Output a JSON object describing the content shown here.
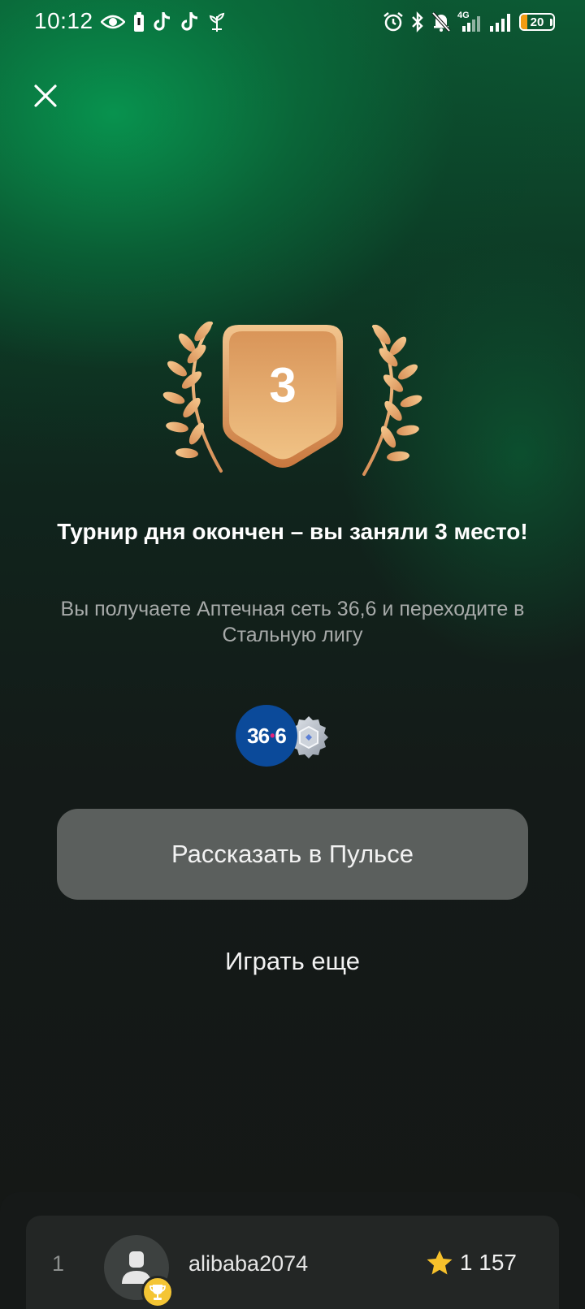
{
  "status_bar": {
    "time": "10:12",
    "network": "4G",
    "battery_level": "20",
    "battery_fraction": 0.2,
    "icons_left": [
      "eye-icon",
      "battery-saver-icon",
      "tiktok-icon",
      "tiktok-icon",
      "plant-icon"
    ],
    "icons_right": [
      "alarm-icon",
      "bluetooth-icon",
      "bell-off-icon",
      "mobile-signal-icon",
      "wifi-signal-icon",
      "battery-icon"
    ]
  },
  "result": {
    "place": "3",
    "title": "Турнир дня окончен – вы заняли 3 место!",
    "subtitle": "Вы получаете Аптечная сеть 36,6 и переходите в Стальную лигу"
  },
  "rewards": {
    "pharmacy_logo_left": "36",
    "pharmacy_logo_right": "6",
    "league_icon": "steel-league-icon"
  },
  "actions": {
    "share_label": "Рассказать в Пульсе",
    "play_again_label": "Играть еще"
  },
  "leaderboard": {
    "rows": [
      {
        "rank": "1",
        "username": "alibaba2074",
        "score": "1 157"
      }
    ]
  },
  "colors": {
    "accent_green": "#0b8a4c",
    "badge_bronze": "#e3a46a",
    "button_bg": "#5b5f5d",
    "trophy_gold": "#f4c534"
  }
}
